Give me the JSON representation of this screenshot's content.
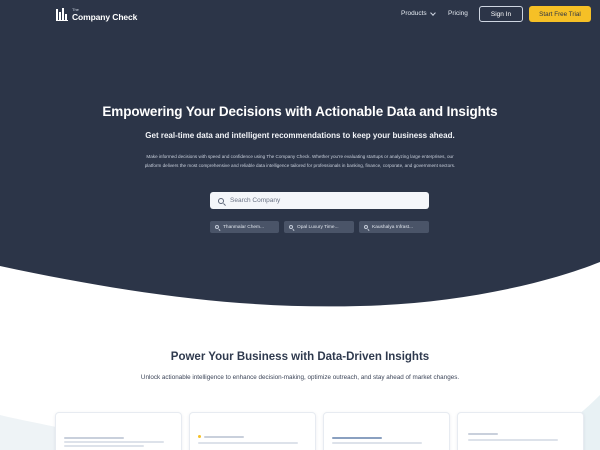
{
  "nav": {
    "logo_prefix": "The",
    "logo_name": "Company Check",
    "products": "Products",
    "pricing": "Pricing",
    "sign_in": "Sign In",
    "start_trial": "Start Free Trial"
  },
  "hero": {
    "title": "Empowering Your Decisions with Actionable Data and Insights",
    "subtitle": "Get real-time data and intelligent recommendations to keep your business ahead.",
    "description": "Make informed decisions with speed and confidence using The Company Check. Whether you're evaluating startups or analyzing large enterprises, our platform delivers the most comprehensive and reliable data intelligence tailored for professionals in banking, finance, corporate, and government sectors.",
    "search_placeholder": "Search Company",
    "recent_searches": [
      "Thanmalar Chem...",
      "Opal Luxury Time...",
      "Kaushalya Infrast..."
    ]
  },
  "section": {
    "title": "Power Your Business with Data-Driven Insights",
    "subtitle": "Unlock actionable intelligence to enhance decision-making, optimize outreach, and stay ahead of market changes."
  },
  "colors": {
    "hero_bg": "#2c3548",
    "accent": "#f6c026",
    "chip_bg": "#4a5468"
  },
  "icons": {
    "logo": "bar-chart-logo-icon",
    "search": "search-icon",
    "products_dropdown": "chevron-down-icon"
  }
}
